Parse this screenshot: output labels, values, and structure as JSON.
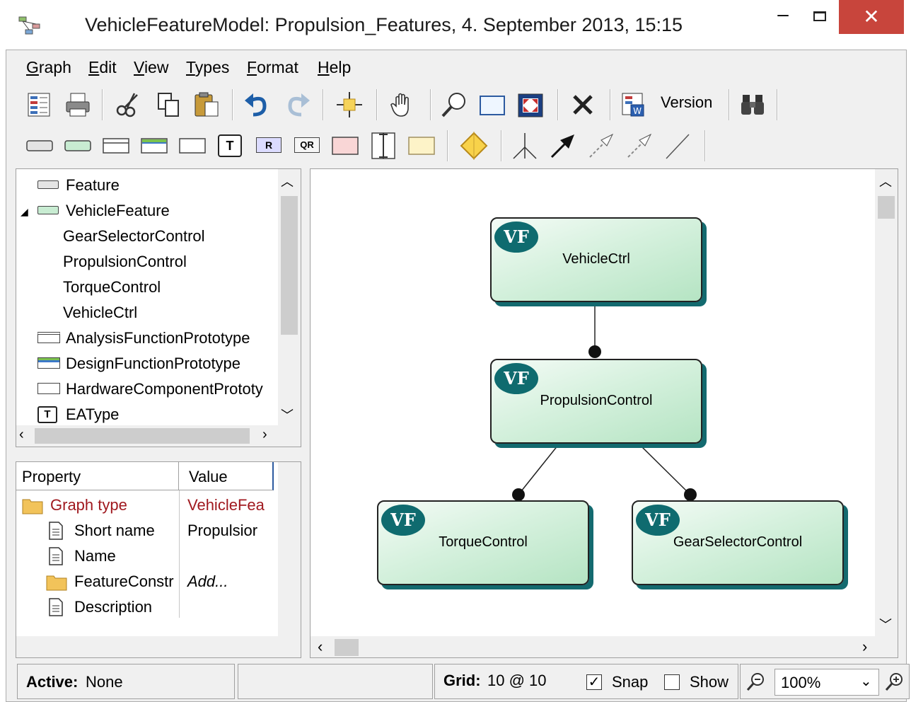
{
  "window": {
    "title": "VehicleFeatureModel: Propulsion_Features, 4. September 2013, 15:15",
    "minimize": "–",
    "close": "✕"
  },
  "menu": [
    {
      "label": "Graph"
    },
    {
      "label": "Edit"
    },
    {
      "label": "View"
    },
    {
      "label": "Types"
    },
    {
      "label": "Format"
    },
    {
      "label": "Help"
    }
  ],
  "toolbar1": {
    "version_label": "Version",
    "icons": [
      "properties-icon",
      "print-icon",
      "cut-icon",
      "copy-icon",
      "paste-icon",
      "undo-icon",
      "redo-icon",
      "center-icon",
      "pan-hand-icon",
      "zoom-icon",
      "rectangle-select-icon",
      "fit-icon",
      "delete-icon",
      "word-export-icon",
      "binoculars-icon"
    ]
  },
  "toolbar2": {
    "icons": [
      "feature-shape-icon",
      "vehicle-feature-shape-icon",
      "analysis-prototype-shape-icon",
      "design-prototype-shape-icon",
      "hardware-prototype-shape-icon",
      "eatype-shape-icon",
      "requirement-shape-icon",
      "quality-requirement-shape-icon",
      "pink-shape-icon",
      "vertical-bar-shape-icon",
      "note-shape-icon",
      "diamond-connector-icon",
      "branch-connector-icon",
      "arrow-connector-icon",
      "dashed-arrow-connector-icon",
      "dashed-arrow2-connector-icon",
      "line-connector-icon"
    ],
    "r_label": "R",
    "qr_label": "QR",
    "t_label": "T"
  },
  "tree": {
    "items": [
      {
        "label": "Feature",
        "icon": "gray-rect-icon"
      },
      {
        "label": "VehicleFeature",
        "icon": "green-rect-icon",
        "expanded": true
      },
      {
        "label": "GearSelectorControl"
      },
      {
        "label": "PropulsionControl"
      },
      {
        "label": "TorqueControl"
      },
      {
        "label": "VehicleCtrl"
      },
      {
        "label": "AnalysisFunctionPrototype",
        "icon": "split-rect-icon"
      },
      {
        "label": "DesignFunctionPrototype",
        "icon": "blue-green-rect-icon"
      },
      {
        "label": "HardwareComponentPrototy",
        "icon": "white-rect-icon"
      },
      {
        "label": "EAType",
        "icon": "t-icon"
      }
    ]
  },
  "properties": {
    "header_property": "Property",
    "header_value": "Value",
    "rows": [
      {
        "property": "Graph type",
        "value": "VehicleFea",
        "icon": "folder-icon",
        "color": "#a0191f"
      },
      {
        "property": "Short name",
        "value": "Propulsior",
        "icon": "document-icon"
      },
      {
        "property": "Name",
        "value": "",
        "icon": "document-icon"
      },
      {
        "property": "FeatureConstr",
        "value": "Add...",
        "icon": "folder-icon"
      },
      {
        "property": "Description",
        "value": "",
        "icon": "document-icon"
      }
    ]
  },
  "diagram": {
    "badge": "VF",
    "nodes": [
      {
        "label": "VehicleCtrl"
      },
      {
        "label": "PropulsionControl"
      },
      {
        "label": "TorqueControl"
      },
      {
        "label": "GearSelectorControl"
      }
    ],
    "accent": "#0f6b6f"
  },
  "status": {
    "active_label": "Active:",
    "active_value": "None",
    "grid_label": "Grid:",
    "grid_value": "10 @ 10",
    "snap_label": "Snap",
    "snap_checked": true,
    "show_label": "Show",
    "show_checked": false,
    "zoom_value": "100%"
  }
}
